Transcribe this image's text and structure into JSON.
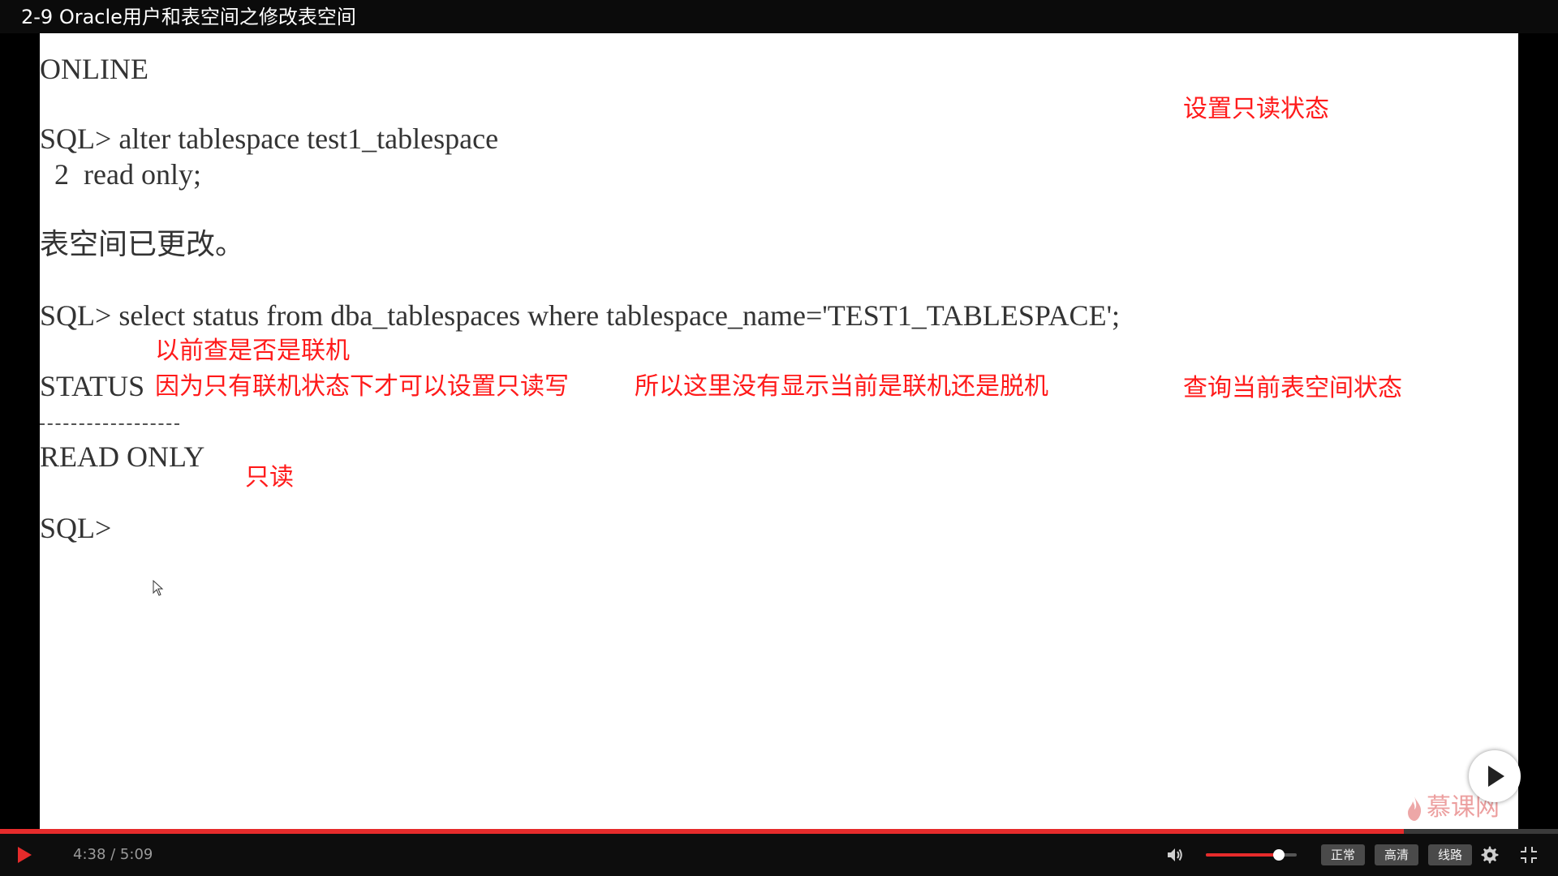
{
  "window": {
    "title": "2-9 Oracle用户和表空间之修改表空间"
  },
  "terminal": {
    "online_value": "ONLINE",
    "cmd1_line1": "SQL> alter tablespace test1_tablespace",
    "cmd1_line2": "  2  read only;",
    "cmd1_result": "表空间已更改。",
    "cmd2_line": "SQL> select status from dba_tablespaces where tablespace_name='TEST1_TABLESPACE';",
    "column_header": "STATUS",
    "status_value": "READ ONLY",
    "prompt": "SQL>"
  },
  "annotations": {
    "set_readonly": "设置只读状态",
    "previously_online": "以前查是否是联机",
    "only_online_can_set": "因为只有联机状态下才可以设置只读写",
    "so_not_shown": "所以这里没有显示当前是联机还是脱机",
    "query_status": "查询当前表空间状态",
    "readonly": "只读"
  },
  "watermark": {
    "text": "慕课网"
  },
  "player": {
    "progress": 0.901,
    "current_time": "4:38",
    "duration": "5:09",
    "time_text": "4:38 / 5:09",
    "volume": 0.8,
    "speed_label": "正常",
    "quality_label": "高清",
    "line_label": "线路",
    "accent_color": "#e62b2b",
    "icons": {
      "play": "play-icon",
      "big_play": "big-play-icon",
      "volume": "volume-icon",
      "settings": "gear-icon",
      "exit_fullscreen": "exit-fullscreen-icon"
    }
  }
}
